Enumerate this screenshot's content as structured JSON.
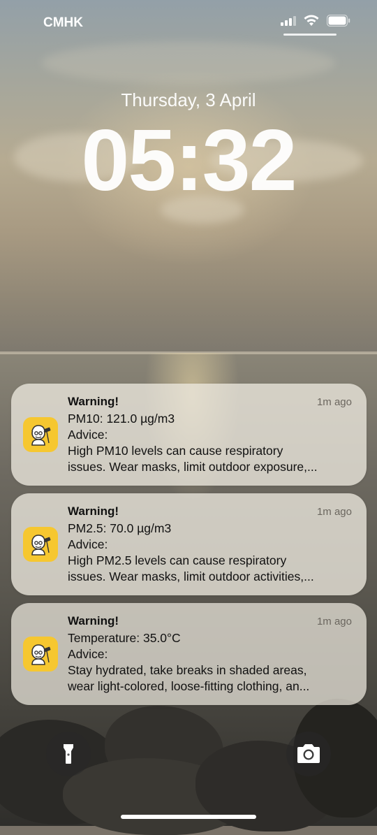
{
  "status_bar": {
    "carrier": "CMHK"
  },
  "lock_screen": {
    "date": "Thursday, 3 April",
    "time": "05:32"
  },
  "notifications": [
    {
      "title": "Warning!",
      "time": "1m ago",
      "line1": "PM10: 121.0 µg/m3",
      "line2": "Advice:",
      "line3": "High PM10 levels can cause respiratory",
      "line4": "issues. Wear masks, limit outdoor exposure,..."
    },
    {
      "title": "Warning!",
      "time": "1m ago",
      "line1": "PM2.5: 70.0 µg/m3",
      "line2": "Advice:",
      "line3": "High PM2.5 levels can cause respiratory",
      "line4": "issues. Wear masks, limit outdoor activities,..."
    },
    {
      "title": "Warning!",
      "time": "1m ago",
      "line1": "Temperature: 35.0°C",
      "line2": "Advice:",
      "line3": "Stay hydrated, take breaks in shaded areas,",
      "line4": "wear light-colored, loose-fitting clothing, an..."
    }
  ],
  "icons": {
    "app": "scientist-app-icon",
    "left_button": "flashlight-icon",
    "right_button": "camera-icon"
  },
  "colors": {
    "app_icon_bg": "#f6c730"
  }
}
